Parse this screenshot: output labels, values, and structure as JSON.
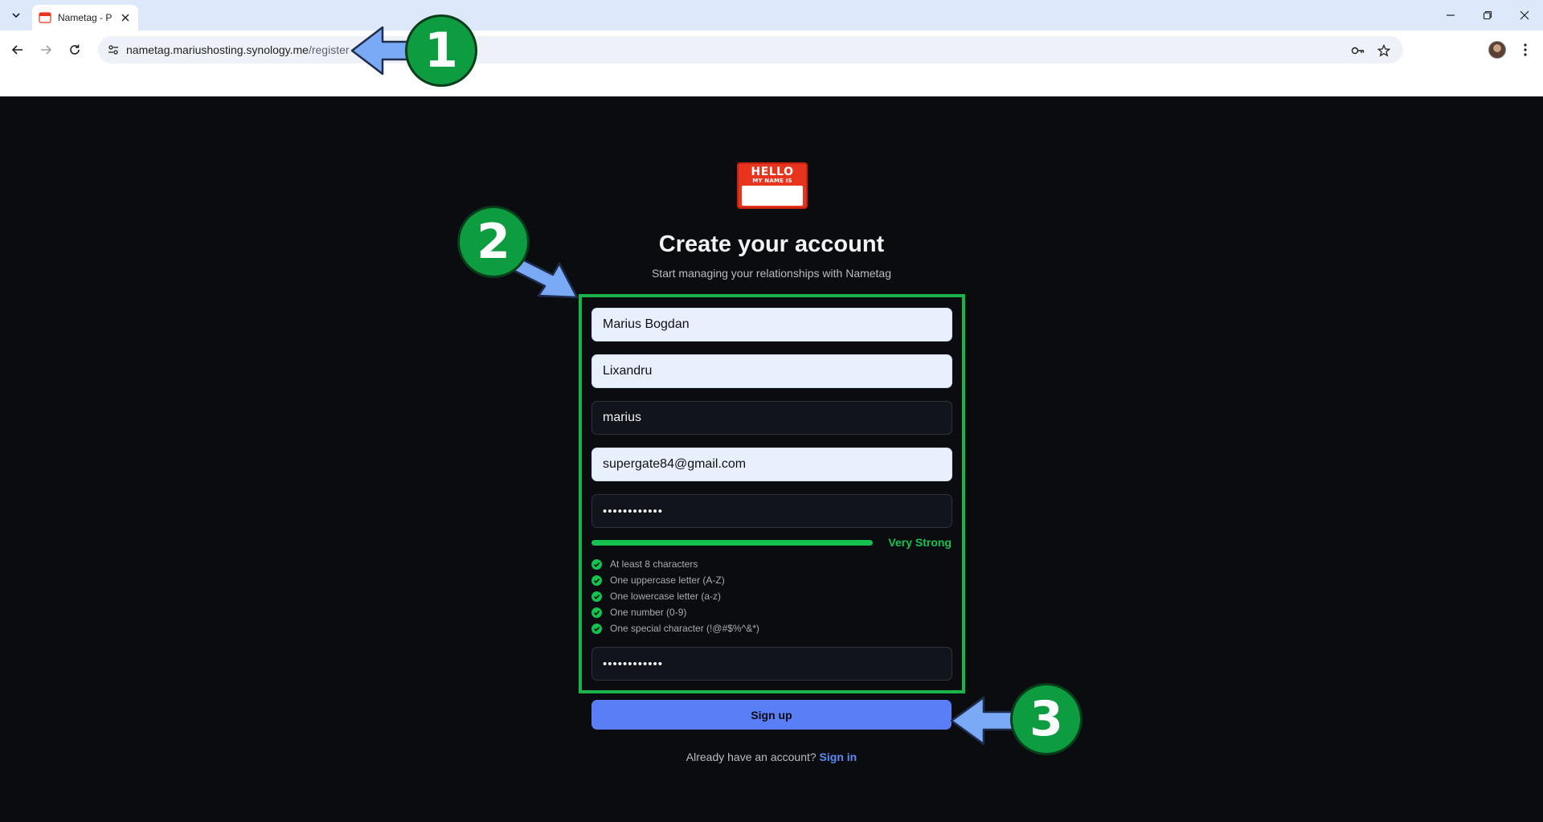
{
  "browser": {
    "tab_title": "Nametag - P",
    "url_host": "nametag.mariushosting.synology.me",
    "url_path": "/register"
  },
  "logo": {
    "line1": "HELLO",
    "line2": "MY NAME IS"
  },
  "page": {
    "heading": "Create your account",
    "subheading": "Start managing your relationships with Nametag"
  },
  "form": {
    "first_name": "Marius Bogdan",
    "last_name": "Lixandru",
    "username": "marius",
    "email": "supergate84@gmail.com",
    "password_mask": "••••••••••••",
    "confirm_password_mask": "••••••••••••",
    "strength": {
      "label": "Very Strong",
      "level": 1.0,
      "color": "#16c24f"
    },
    "requirements": [
      {
        "text": "At least 8 characters",
        "met": true
      },
      {
        "text": "One uppercase letter (A-Z)",
        "met": true
      },
      {
        "text": "One lowercase letter (a-z)",
        "met": true
      },
      {
        "text": "One number (0-9)",
        "met": true
      },
      {
        "text": "One special character (!@#$%^&*)",
        "met": true
      }
    ],
    "submit_label": "Sign up"
  },
  "signin": {
    "prompt": "Already have an account?",
    "link": "Sign in"
  },
  "annotations": {
    "badge1": "1",
    "badge2": "2",
    "badge3": "3"
  },
  "colors": {
    "background": "#0b0c10",
    "accent": "#5a7ef5",
    "highlight": "#1ab34a",
    "badge": "#0e9c40",
    "arrow": "#7aaaf5"
  }
}
